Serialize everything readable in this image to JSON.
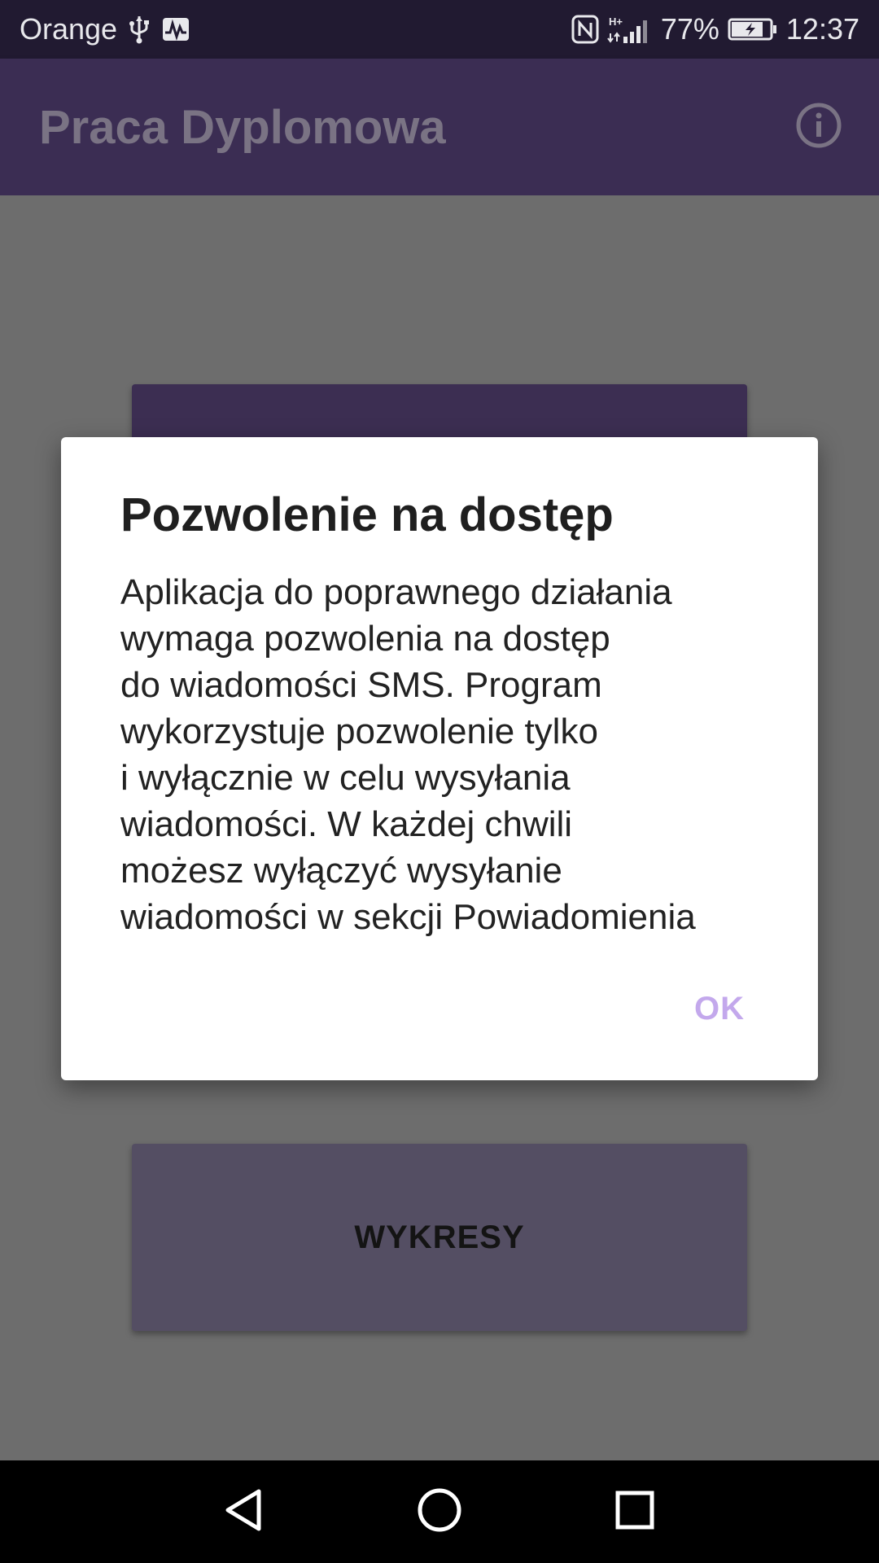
{
  "status_bar": {
    "carrier": "Orange",
    "network_type": "H+",
    "battery_percent": "77%",
    "time": "12:37",
    "icons": [
      "usb-icon",
      "activity-icon",
      "nfc-icon",
      "signal-icon",
      "battery-charging-icon"
    ]
  },
  "app_bar": {
    "title": "Praca Dyplomowa",
    "info_icon": "info-icon"
  },
  "menu": {
    "top_button_label": "",
    "bottom_button_label": "WYKRESY"
  },
  "dialog": {
    "title": "Pozwolenie na dostęp",
    "message_lines": [
      "Aplikacja do poprawnego działania",
      "wymaga pozwolenia na dostęp",
      "do wiadomości SMS. Program",
      "wykorzystuje pozwolenie tylko",
      "i wyłącznie w celu wysyłania",
      "wiadomości. W każdej chwili",
      "możesz wyłączyć wysyłanie",
      "wiadomości w sekcji Powiadomienia"
    ],
    "ok_label": "OK"
  },
  "nav_bar": {
    "icons": [
      "back-icon",
      "home-icon",
      "recents-icon"
    ]
  },
  "colors": {
    "status_bar": "#211a31",
    "app_bar": "#3b2d53",
    "accent": "#c3a8ec",
    "background_dimmed": "#6d6d6d"
  }
}
